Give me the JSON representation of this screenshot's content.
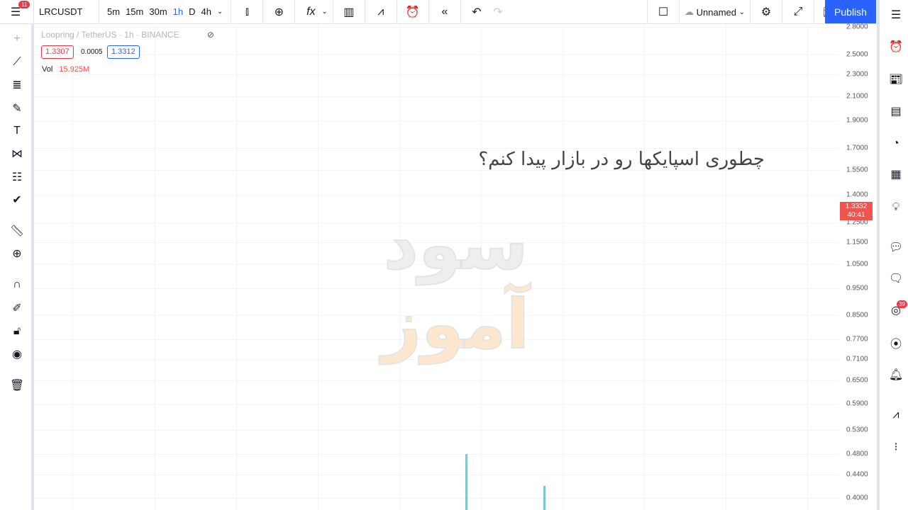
{
  "header": {
    "notifications": "11",
    "symbol": "LRCUSDT",
    "timeframes": [
      "5m",
      "15m",
      "30m",
      "1h",
      "D",
      "4h"
    ],
    "active_timeframe": "1h",
    "layout_name": "Unnamed",
    "publish": "Publish",
    "icons": [
      "candles-icon",
      "compare-add-icon",
      "indicators-icon",
      "chevron-down-icon",
      "templates-icon",
      "alert-add-icon",
      "replay-icon",
      "undo-icon",
      "redo-icon"
    ]
  },
  "legend": {
    "title": "Loopring / TetherUS · 1h · BINANCE",
    "bid": "1.3307",
    "spread": "0.0005",
    "ask": "1.3312",
    "vol_label": "Vol",
    "vol_value": "15.925M"
  },
  "overlay": {
    "question": "چطوری اسپایکها رو در بازار پیدا کنم؟",
    "watermark": "سود آموز"
  },
  "price_axis": {
    "scale": "log",
    "ticks": [
      "2.8000",
      "2.5000",
      "2.3000",
      "2.1000",
      "1.9000",
      "1.7000",
      "1.5500",
      "1.4000",
      "1.2500",
      "1.1500",
      "1.0500",
      "0.9500",
      "0.8500",
      "0.7700",
      "0.7100",
      "0.6500",
      "0.5900",
      "0.5300",
      "0.4800",
      "0.4400",
      "0.4000"
    ],
    "current_price": "1.3332",
    "countdown": "40:41",
    "current_color": "#f0544f"
  },
  "right_panel": {
    "ideas_badge": "39"
  },
  "colors": {
    "accent": "#2962ff",
    "bid": "#f23645",
    "ask": "#2962ff",
    "candle": "#7fc7c6"
  }
}
